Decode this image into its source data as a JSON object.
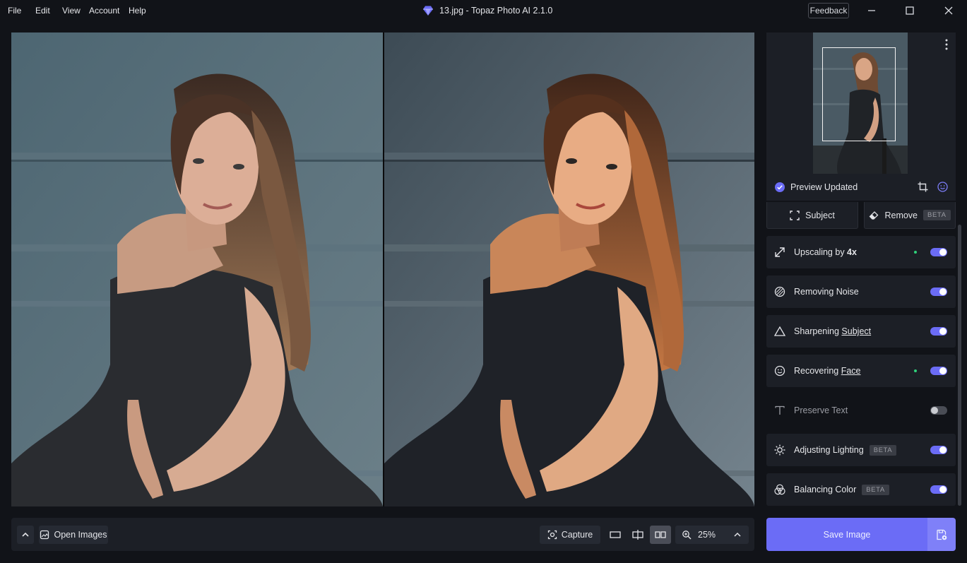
{
  "menu": [
    "File",
    "Edit",
    "View",
    "Account",
    "Help"
  ],
  "window_title": "13.jpg - Topaz Photo AI 2.1.0",
  "feedback_label": "Feedback",
  "preview": {
    "status": "Preview Updated"
  },
  "masks": {
    "subject_label": "Subject",
    "remove_label": "Remove",
    "remove_badge": "BETA"
  },
  "enhancements": [
    {
      "prefix": "Upscaling by ",
      "suffix": "4x",
      "enabled": true,
      "changed": true,
      "icon": "resize-arrow-icon"
    },
    {
      "prefix": "Removing Noise",
      "suffix": "",
      "enabled": true,
      "changed": false,
      "icon": "noise-icon"
    },
    {
      "prefix": "Sharpening ",
      "suffix": "Subject",
      "enabled": true,
      "changed": false,
      "icon": "triangle-icon"
    },
    {
      "prefix": "Recovering ",
      "suffix": "Face",
      "enabled": true,
      "changed": true,
      "icon": "face-icon"
    },
    {
      "prefix": "Preserve Text",
      "suffix": "",
      "enabled": false,
      "changed": false,
      "icon": "text-icon"
    },
    {
      "prefix": "Adjusting Lighting",
      "suffix": "",
      "badge": "BETA",
      "enabled": true,
      "changed": false,
      "icon": "sun-icon"
    },
    {
      "prefix": "Balancing Color",
      "suffix": "",
      "badge": "BETA",
      "enabled": true,
      "changed": false,
      "icon": "color-balance-icon"
    }
  ],
  "bottom_bar": {
    "open_images_label": "Open Images",
    "capture_label": "Capture",
    "zoom": "25%"
  },
  "save_label": "Save Image",
  "colors": {
    "accent": "#6b6cf6",
    "changed_dot": "#2fd17a"
  }
}
